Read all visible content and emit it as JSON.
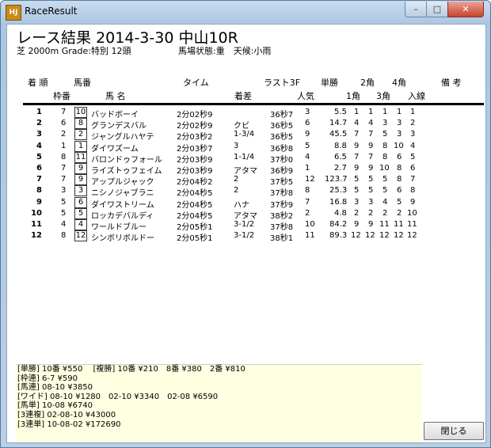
{
  "window": {
    "title": "RaceResult",
    "minimize": "–",
    "maximize": "□",
    "close": "✕",
    "icon_text": "HJ"
  },
  "race": {
    "title": "レース結果 2014-3-30 中山10R",
    "info_left": "芝 2000m Grade:特別 12頭",
    "info_right": "馬場状態:重　天候:小雨"
  },
  "headers": {
    "order": "着 順",
    "horse_num": "馬番",
    "time": "タイム",
    "last3f": "ラスト3F",
    "win": "単勝",
    "c2": "2角",
    "c4": "4角",
    "note": "備 考",
    "frame": "枠番",
    "name": "馬 名",
    "margin": "着差",
    "pop": "人気",
    "c1": "1角",
    "c3": "3角",
    "entry": "入線"
  },
  "rows": [
    {
      "pos": "1",
      "frame": "7",
      "num": "10",
      "name": "バッドボーイ",
      "time": "2分02秒9",
      "margin": "",
      "last3f": "36秒7",
      "pop": "3",
      "odds": "5.5",
      "c1": "1",
      "c2": "1",
      "c3": "1",
      "c4": "1",
      "entry": "1"
    },
    {
      "pos": "2",
      "frame": "6",
      "num": "8",
      "name": "グランデスバル",
      "time": "2分02秒9",
      "margin": "クビ",
      "last3f": "36秒5",
      "pop": "6",
      "odds": "14.7",
      "c1": "4",
      "c2": "4",
      "c3": "3",
      "c4": "3",
      "entry": "2"
    },
    {
      "pos": "3",
      "frame": "2",
      "num": "2",
      "name": "ジャングルハヤテ",
      "time": "2分03秒2",
      "margin": "1-3/4",
      "last3f": "36秒5",
      "pop": "9",
      "odds": "45.5",
      "c1": "7",
      "c2": "7",
      "c3": "5",
      "c4": "3",
      "entry": "3"
    },
    {
      "pos": "4",
      "frame": "1",
      "num": "1",
      "name": "ダイワズーム",
      "time": "2分03秒7",
      "margin": "3",
      "last3f": "36秒8",
      "pop": "5",
      "odds": "8.8",
      "c1": "9",
      "c2": "9",
      "c3": "8",
      "c4": "10",
      "entry": "4"
    },
    {
      "pos": "5",
      "frame": "8",
      "num": "11",
      "name": "バロンドゥフォール",
      "time": "2分03秒9",
      "margin": "1-1/4",
      "last3f": "37秒0",
      "pop": "4",
      "odds": "6.5",
      "c1": "7",
      "c2": "7",
      "c3": "8",
      "c4": "6",
      "entry": "5"
    },
    {
      "pos": "6",
      "frame": "7",
      "num": "9",
      "name": "ライズトゥフェイム",
      "time": "2分03秒9",
      "margin": "アタマ",
      "last3f": "36秒9",
      "pop": "1",
      "odds": "2.7",
      "c1": "9",
      "c2": "9",
      "c3": "10",
      "c4": "8",
      "entry": "6"
    },
    {
      "pos": "7",
      "frame": "7",
      "num": "9",
      "name": "アップルジャック",
      "time": "2分04秒2",
      "margin": "2",
      "last3f": "37秒5",
      "pop": "12",
      "odds": "123.7",
      "c1": "5",
      "c2": "5",
      "c3": "5",
      "c4": "8",
      "entry": "7"
    },
    {
      "pos": "8",
      "frame": "3",
      "num": "3",
      "name": "ニシノジャブラニ",
      "time": "2分04秒5",
      "margin": "2",
      "last3f": "37秒8",
      "pop": "8",
      "odds": "25.3",
      "c1": "5",
      "c2": "5",
      "c3": "5",
      "c4": "6",
      "entry": "8"
    },
    {
      "pos": "9",
      "frame": "5",
      "num": "6",
      "name": "ダイワストリーム",
      "time": "2分04秒5",
      "margin": "ハナ",
      "last3f": "37秒9",
      "pop": "7",
      "odds": "16.8",
      "c1": "3",
      "c2": "3",
      "c3": "4",
      "c4": "5",
      "entry": "9"
    },
    {
      "pos": "10",
      "frame": "5",
      "num": "5",
      "name": "ロッカデバルディ",
      "time": "2分04秒5",
      "margin": "アタマ",
      "last3f": "38秒2",
      "pop": "2",
      "odds": "4.8",
      "c1": "2",
      "c2": "2",
      "c3": "2",
      "c4": "2",
      "entry": "10"
    },
    {
      "pos": "11",
      "frame": "4",
      "num": "4",
      "name": "ワールドブルー",
      "time": "2分05秒1",
      "margin": "3-1/2",
      "last3f": "37秒8",
      "pop": "10",
      "odds": "84.2",
      "c1": "9",
      "c2": "9",
      "c3": "11",
      "c4": "11",
      "entry": "11"
    },
    {
      "pos": "12",
      "frame": "8",
      "num": "12",
      "name": "シンボリボルドー",
      "time": "2分05秒1",
      "margin": "3-1/2",
      "last3f": "38秒1",
      "pop": "11",
      "odds": "89.3",
      "c1": "12",
      "c2": "12",
      "c3": "12",
      "c4": "12",
      "entry": "12"
    }
  ],
  "payouts": [
    "[単勝] 10番 ¥550　 [複勝] 10番 ¥210　8番 ¥380　2番 ¥810",
    "[枠連] 6-7 ¥590",
    "[馬連] 08-10 ¥3850",
    "[ワイド] 08-10 ¥1280　02-10 ¥3340　02-08 ¥6590",
    "[馬単] 10-08 ¥6740",
    "[3連複] 02-08-10 ¥43000",
    "[3連単] 10-08-02 ¥172690"
  ],
  "buttons": {
    "close": "閉じる"
  }
}
